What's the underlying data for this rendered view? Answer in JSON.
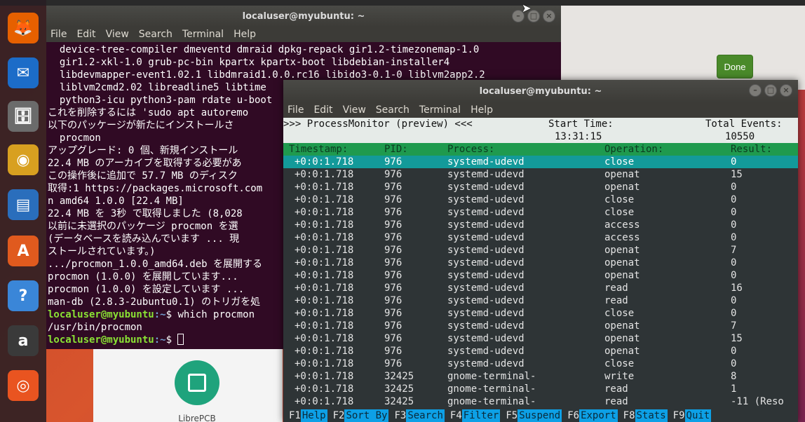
{
  "desktop": {
    "launcher": [
      {
        "name": "firefox",
        "glyph": "🦊",
        "color": "#e66000"
      },
      {
        "name": "thunderbird",
        "glyph": "✉",
        "color": "#1c6cc8"
      },
      {
        "name": "files",
        "glyph": "🗄",
        "color": "#6b6b6b"
      },
      {
        "name": "rhythmbox",
        "glyph": "◉",
        "color": "#d8a020"
      },
      {
        "name": "libreoffice-writer",
        "glyph": "▤",
        "color": "#2a6ebc"
      },
      {
        "name": "software-center",
        "glyph": "A",
        "color": "#e05a1e"
      },
      {
        "name": "help",
        "glyph": "?",
        "color": "#3a86d8"
      },
      {
        "name": "amazon",
        "glyph": "a",
        "color": "#3a3a3a"
      },
      {
        "name": "ubuntu",
        "glyph": "◎",
        "color": "#e95420"
      }
    ],
    "settings_done": "Done",
    "software_app_name": "LibrePCB"
  },
  "term1": {
    "title": "localuser@myubuntu: ~",
    "menu": [
      "File",
      "Edit",
      "View",
      "Search",
      "Terminal",
      "Help"
    ],
    "lines": [
      "  device-tree-compiler dmeventd dmraid dpkg-repack gir1.2-timezonemap-1.0",
      "  gir1.2-xkl-1.0 grub-pc-bin kpartx kpartx-boot libdebian-installer4",
      "  libdevmapper-event1.02.1 libdmraid1.0.0.rc16 libido3-0.1-0 liblvm2app2.2",
      "  liblvm2cmd2.02 libreadline5 libtime",
      "  python3-icu python3-pam rdate u-boot",
      "これを削除するには 'sudo apt autoremo",
      "以下のパッケージが新たにインストールさ",
      "  procmon",
      "アップグレード: 0 個、新規インストール",
      "22.4 MB のアーカイブを取得する必要があ",
      "この操作後に追加で 57.7 MB のディスク",
      "取得:1 https://packages.microsoft.com",
      "n amd64 1.0.0 [22.4 MB]",
      "22.4 MB を 3秒 で取得しました (8,028 ",
      "以前に未選択のパッケージ procmon を選",
      "(データベースを読み込んでいます ... 現",
      "ストールされています。)",
      ".../procmon_1.0.0_amd64.deb を展開する",
      "procmon (1.0.0) を展開しています...",
      "procmon (1.0.0) を設定しています ...",
      "man-db (2.8.3-2ubuntu0.1) のトリガを処"
    ],
    "prompt_user": "localuser@myubuntu",
    "prompt_path": ":~",
    "prompt_symbol": "$ ",
    "command": "which procmon",
    "output": "/usr/bin/procmon"
  },
  "term2": {
    "title": "localuser@myubuntu: ~",
    "menu": [
      "File",
      "Edit",
      "View",
      "Search",
      "Terminal",
      "Help"
    ],
    "procmon": {
      "banner": ">>> ProcessMonitor (preview) <<<",
      "start_label": "Start Time:",
      "start_value": "13:31:15",
      "events_label": "Total Events:",
      "events_value": "10550",
      "columns": [
        "Timestamp:",
        "PID:",
        "Process:",
        "Operation:",
        "Result:"
      ],
      "rows": [
        [
          "+0:0:1.718",
          "976",
          "systemd-udevd",
          "close",
          "0"
        ],
        [
          "+0:0:1.718",
          "976",
          "systemd-udevd",
          "openat",
          "15"
        ],
        [
          "+0:0:1.718",
          "976",
          "systemd-udevd",
          "openat",
          "0"
        ],
        [
          "+0:0:1.718",
          "976",
          "systemd-udevd",
          "close",
          "0"
        ],
        [
          "+0:0:1.718",
          "976",
          "systemd-udevd",
          "close",
          "0"
        ],
        [
          "+0:0:1.718",
          "976",
          "systemd-udevd",
          "access",
          "0"
        ],
        [
          "+0:0:1.718",
          "976",
          "systemd-udevd",
          "access",
          "0"
        ],
        [
          "+0:0:1.718",
          "976",
          "systemd-udevd",
          "openat",
          "7"
        ],
        [
          "+0:0:1.718",
          "976",
          "systemd-udevd",
          "openat",
          "0"
        ],
        [
          "+0:0:1.718",
          "976",
          "systemd-udevd",
          "openat",
          "0"
        ],
        [
          "+0:0:1.718",
          "976",
          "systemd-udevd",
          "read",
          "16"
        ],
        [
          "+0:0:1.718",
          "976",
          "systemd-udevd",
          "read",
          "0"
        ],
        [
          "+0:0:1.718",
          "976",
          "systemd-udevd",
          "close",
          "0"
        ],
        [
          "+0:0:1.718",
          "976",
          "systemd-udevd",
          "openat",
          "7"
        ],
        [
          "+0:0:1.718",
          "976",
          "systemd-udevd",
          "openat",
          "15"
        ],
        [
          "+0:0:1.718",
          "976",
          "systemd-udevd",
          "openat",
          "0"
        ],
        [
          "+0:0:1.718",
          "976",
          "systemd-udevd",
          "close",
          "0"
        ],
        [
          "+0:0:1.718",
          "32425",
          "gnome-terminal-",
          "write",
          "8"
        ],
        [
          "+0:0:1.718",
          "32425",
          "gnome-terminal-",
          "read",
          "1"
        ],
        [
          "+0:0:1.718",
          "32425",
          "gnome-terminal-",
          "read",
          "-11 (Reso"
        ]
      ],
      "selected_row": 0,
      "footer": [
        {
          "key": "F1",
          "label": "Help"
        },
        {
          "key": "F2",
          "label": "Sort By"
        },
        {
          "key": "F3",
          "label": "Search"
        },
        {
          "key": "F4",
          "label": "Filter"
        },
        {
          "key": "F5",
          "label": "Suspend"
        },
        {
          "key": "F6",
          "label": "Export"
        },
        {
          "key": "F8",
          "label": "Stats"
        },
        {
          "key": "F9",
          "label": "Quit"
        }
      ]
    }
  }
}
